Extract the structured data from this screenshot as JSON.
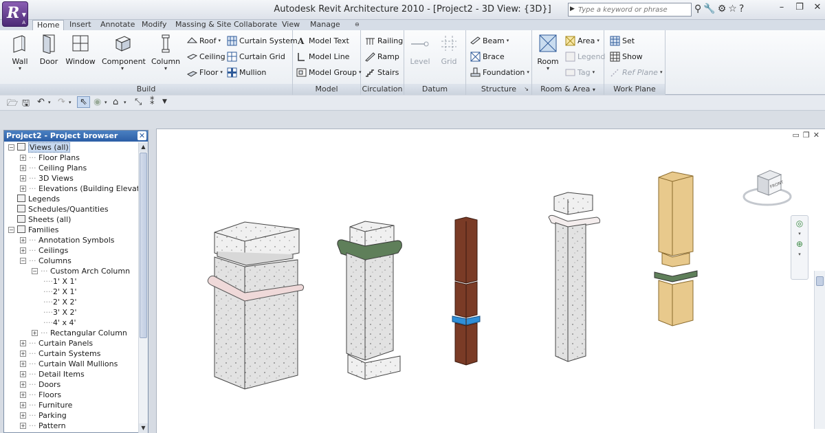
{
  "app": {
    "title": "Autodesk Revit Architecture 2010 - [Project2 - 3D View: {3D}]",
    "search_placeholder": "Type a keyword or phrase",
    "app_button_letter": "R",
    "app_button_sub": "A"
  },
  "tabs": [
    {
      "label": "Home",
      "active": true
    },
    {
      "label": "Insert"
    },
    {
      "label": "Annotate"
    },
    {
      "label": "Modify"
    },
    {
      "label": "Massing & Site"
    },
    {
      "label": "Collaborate"
    },
    {
      "label": "View"
    },
    {
      "label": "Manage"
    }
  ],
  "ribbon": {
    "build": {
      "label": "Build",
      "wall": "Wall",
      "door": "Door",
      "window": "Window",
      "component": "Component",
      "column": "Column",
      "roof": "Roof",
      "ceiling": "Ceiling",
      "floor": "Floor",
      "curtain_system": "Curtain System",
      "curtain_grid": "Curtain Grid",
      "mullion": "Mullion"
    },
    "model": {
      "label": "Model",
      "model_text": "Model Text",
      "model_line": "Model Line",
      "model_group": "Model Group"
    },
    "circulation": {
      "label": "Circulation",
      "railing": "Railing",
      "ramp": "Ramp",
      "stairs": "Stairs"
    },
    "datum": {
      "label": "Datum",
      "level": "Level",
      "grid": "Grid"
    },
    "structure": {
      "label": "Structure",
      "beam": "Beam",
      "brace": "Brace",
      "foundation": "Foundation"
    },
    "room_area": {
      "label": "Room & Area",
      "room": "Room",
      "area": "Area",
      "legend": "Legend",
      "tag": "Tag"
    },
    "work_plane": {
      "label": "Work Plane",
      "set": "Set",
      "show": "Show",
      "ref_plane": "Ref Plane"
    }
  },
  "browser": {
    "title": "Project2 - Project browser",
    "items": [
      {
        "label": "Views (all)",
        "level": 0,
        "exp": "−",
        "selected": true
      },
      {
        "label": "Floor Plans",
        "level": 1,
        "exp": "+"
      },
      {
        "label": "Ceiling Plans",
        "level": 1,
        "exp": "+"
      },
      {
        "label": "3D Views",
        "level": 1,
        "exp": "+"
      },
      {
        "label": "Elevations (Building Elevation)",
        "level": 1,
        "exp": "+"
      },
      {
        "label": "Legends",
        "level": 0,
        "exp": ""
      },
      {
        "label": "Schedules/Quantities",
        "level": 0,
        "exp": ""
      },
      {
        "label": "Sheets (all)",
        "level": 0,
        "exp": ""
      },
      {
        "label": "Families",
        "level": 0,
        "exp": "−"
      },
      {
        "label": "Annotation Symbols",
        "level": 1,
        "exp": "+"
      },
      {
        "label": "Ceilings",
        "level": 1,
        "exp": "+"
      },
      {
        "label": "Columns",
        "level": 1,
        "exp": "−"
      },
      {
        "label": "Custom Arch Column",
        "level": 2,
        "exp": "−"
      },
      {
        "label": "1' X 1'",
        "level": 3,
        "exp": ""
      },
      {
        "label": "2' X 1'",
        "level": 3,
        "exp": ""
      },
      {
        "label": "2' X 2'",
        "level": 3,
        "exp": ""
      },
      {
        "label": "3' X 2'",
        "level": 3,
        "exp": ""
      },
      {
        "label": "4' x 4'",
        "level": 3,
        "exp": ""
      },
      {
        "label": "Rectangular Column",
        "level": 2,
        "exp": "+"
      },
      {
        "label": "Curtain Panels",
        "level": 1,
        "exp": "+"
      },
      {
        "label": "Curtain Systems",
        "level": 1,
        "exp": "+"
      },
      {
        "label": "Curtain Wall Mullions",
        "level": 1,
        "exp": "+"
      },
      {
        "label": "Detail Items",
        "level": 1,
        "exp": "+"
      },
      {
        "label": "Doors",
        "level": 1,
        "exp": "+"
      },
      {
        "label": "Floors",
        "level": 1,
        "exp": "+"
      },
      {
        "label": "Furniture",
        "level": 1,
        "exp": "+"
      },
      {
        "label": "Parking",
        "level": 1,
        "exp": "+"
      },
      {
        "label": "Pattern",
        "level": 1,
        "exp": "+"
      }
    ]
  },
  "viewcube": {
    "face": "FRONT"
  },
  "colors": {
    "concrete": "#e4e4e4",
    "band_pink": "#efd9d9",
    "band_green": "#5f7f5a",
    "band_blue": "#2f8fd8",
    "wood_dark": "#7a3b26",
    "wood_light": "#e8c98c"
  }
}
